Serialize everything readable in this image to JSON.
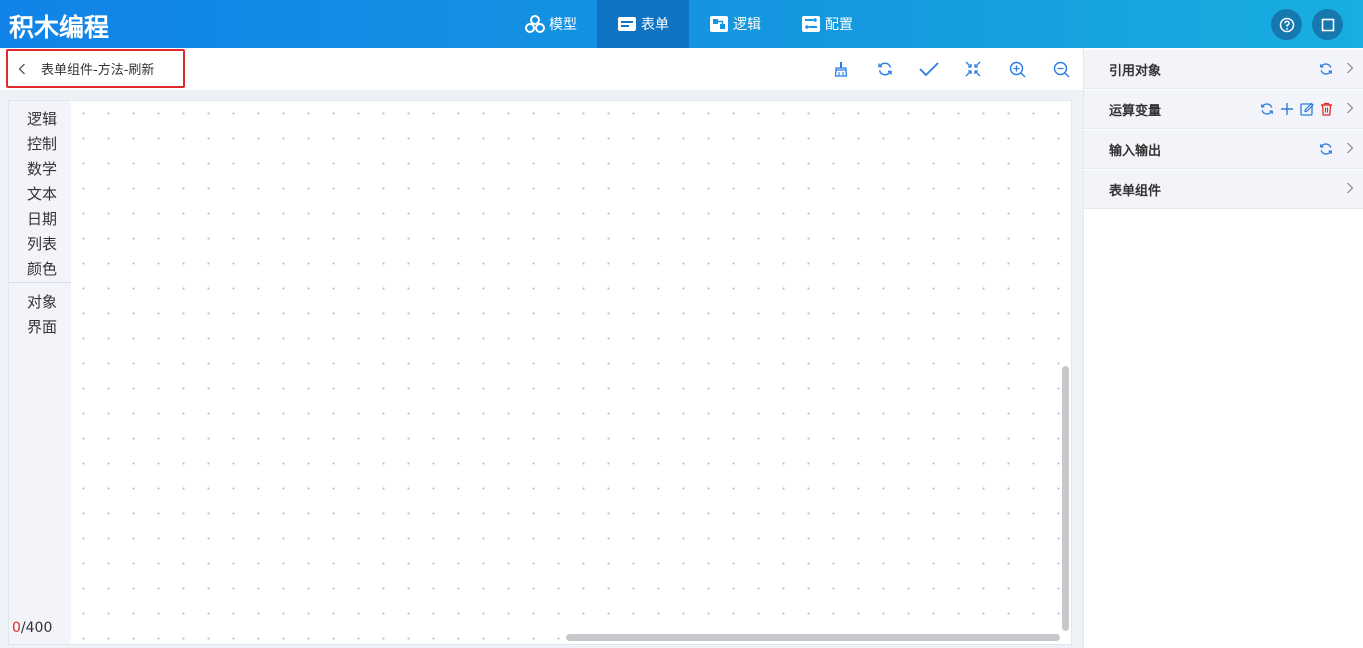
{
  "app": {
    "title": "积木编程"
  },
  "nav": {
    "tabs": [
      {
        "label": "模型",
        "icon": "cubes-icon"
      },
      {
        "label": "表单",
        "icon": "form-icon",
        "active": true
      },
      {
        "label": "逻辑",
        "icon": "logic-icon"
      },
      {
        "label": "配置",
        "icon": "config-icon"
      }
    ]
  },
  "header_actions": [
    {
      "icon": "help-icon"
    },
    {
      "icon": "fullscreen-icon"
    }
  ],
  "breadcrumb": {
    "title": "表单组件-方法-刷新"
  },
  "toolbar": {
    "tools": [
      "broom-icon",
      "refresh-icon",
      "check-icon",
      "collapse-icon",
      "zoom-in-icon",
      "zoom-out-icon"
    ]
  },
  "categories": {
    "group1": [
      "逻辑",
      "控制",
      "数学",
      "文本",
      "日期",
      "列表",
      "颜色"
    ],
    "group2": [
      "对象",
      "界面"
    ]
  },
  "counter": {
    "current": "0",
    "max": "/400"
  },
  "right_panel": {
    "sections": [
      {
        "label": "引用对象",
        "actions": [
          "refresh-icon"
        ]
      },
      {
        "label": "运算变量",
        "actions": [
          "refresh-icon",
          "plus-icon",
          "edit-icon",
          "trash-icon"
        ]
      },
      {
        "label": "输入输出",
        "actions": [
          "refresh-icon"
        ]
      },
      {
        "label": "表单组件",
        "actions": []
      }
    ]
  },
  "colors": {
    "primary": "#1183e8",
    "accent_blue": "#2b7de0",
    "danger": "#e02a2a",
    "panel_bg": "#f2f4f9"
  }
}
